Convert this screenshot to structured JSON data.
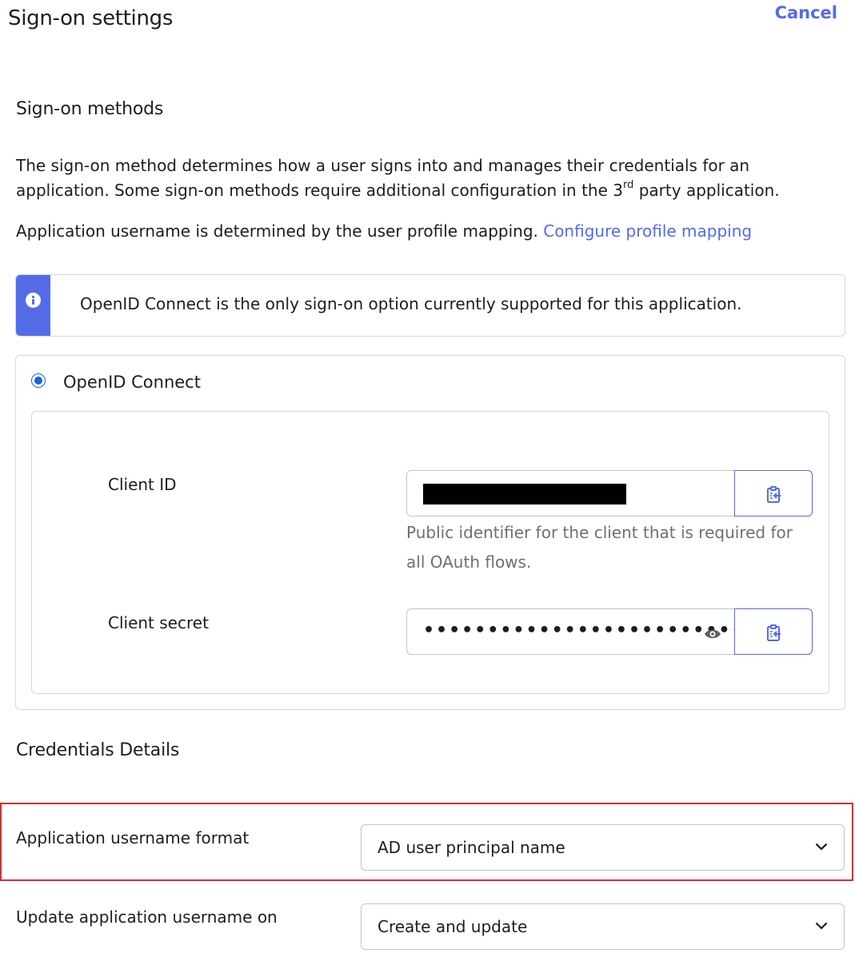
{
  "header": {
    "title": "Sign-on settings",
    "cancel_label": "Cancel"
  },
  "sign_on_methods": {
    "heading": "Sign-on methods",
    "description_part1": "The sign-on method determines how a user signs into and manages their credentials for an application. Some sign-on methods require additional configuration in the 3",
    "description_sup": "rd",
    "description_part2": " party application.",
    "username_note": "Application username is determined by the user profile mapping.",
    "configure_link": "Configure profile mapping",
    "callout_text": "OpenID Connect is the only sign-on option currently supported for this application.",
    "radio_label": "OpenID Connect",
    "client_id": {
      "label": "Client ID",
      "help": "Public identifier for the client that is required for all OAuth flows."
    },
    "client_secret": {
      "label": "Client secret",
      "masked_value": "••••••••••••••••••••••••••••"
    }
  },
  "credentials": {
    "heading": "Credentials Details",
    "username_format": {
      "label": "Application username format",
      "value": "AD user principal name"
    },
    "update_on": {
      "label": "Update application username on",
      "value": "Create and update"
    }
  },
  "colors": {
    "accent": "#546be7",
    "radio": "#1662dd",
    "highlight": "#e02b2b"
  }
}
